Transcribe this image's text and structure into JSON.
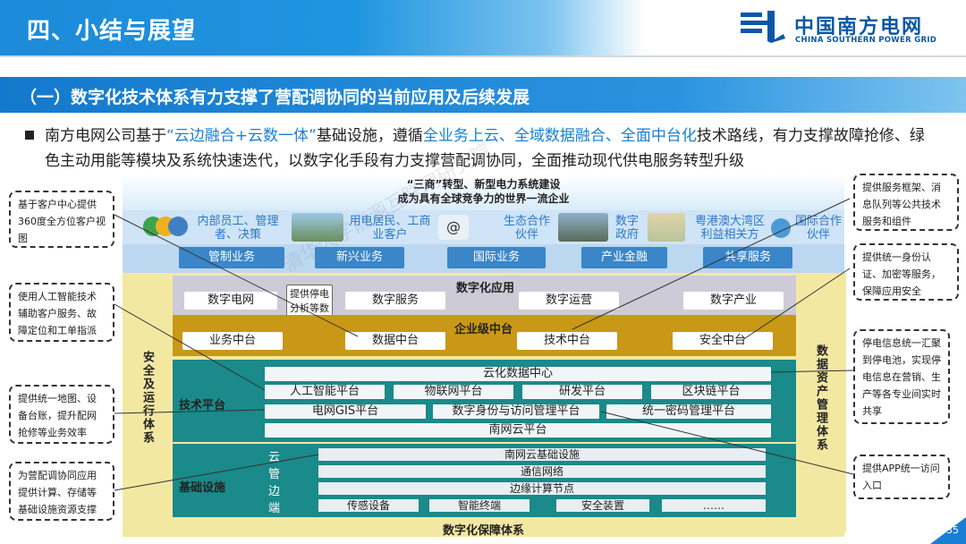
{
  "header": {
    "title": "四、小结与展望",
    "logo_cn": "中国南方电网",
    "logo_en": "CHINA SOUTHERN POWER GRID"
  },
  "section": {
    "title": "（一）数字化技术体系有力支撑了营配调协同的当前应用及后续发展"
  },
  "paragraph": {
    "p1": "南方电网公司基于",
    "h1": "“云边融合+云数一体”",
    "p2": "基础设施，遵循",
    "h2": "全业务上云、全域数据融合、全面中台化",
    "p3": "技术路线，有力支撑故障抢修、绿色主动用能等模块及系统快速迭代，以数字化手段有力支撑营配调协同，全面推动现代供电服务转型升级"
  },
  "diagram": {
    "banner_line1": "“三商”转型、新型电力系统建设",
    "banner_line2": "成为具有全球竞争力的世界一流企业",
    "stakeholders": [
      "内部员工、管理者、决策",
      "用电居民、工商业客户",
      "生态合作伙伴",
      "数字政府",
      "粤港澳大湾区利益相关方",
      "国际合作伙伴"
    ],
    "business": [
      "管制业务",
      "新兴业务",
      "国际业务",
      "产业金融",
      "共享服务"
    ],
    "left_side": "安全及运行体系",
    "right_side": "数据资产管理体系",
    "app_layer": {
      "title": "数字化应用",
      "items": [
        "数字电网",
        "数字服务",
        "数字运营",
        "数字产业"
      ]
    },
    "ent_layer": {
      "title": "企业级中台",
      "items": [
        "业务中台",
        "数据中台",
        "技术中台",
        "安全中台"
      ]
    },
    "tech_layer": {
      "title": "技术平台",
      "top": "云化数据中心",
      "row1": [
        "人工智能平台",
        "物联网平台",
        "研发平台",
        "区块链平台"
      ],
      "row2": [
        "电网GIS平台",
        "数字身份与访问管理平台",
        "统一密码管理平台"
      ],
      "bottom": "南网云平台"
    },
    "base_layer": {
      "title": "基础设施",
      "letters": [
        "云",
        "管",
        "边",
        "端"
      ],
      "rows": [
        "南网云基础设施",
        "通信网络",
        "边缘计算节点"
      ],
      "end_items": [
        "传感设备",
        "智能终端",
        "安全装置",
        "……"
      ]
    },
    "bottom": "数字化保障体系",
    "popup": "提供停电分析等数据服务用"
  },
  "callouts": {
    "l1": "基于客户中心提供360度全方位客户视图",
    "l2": "使用人工智能技术辅助客户服务、故障定位和工单指派",
    "l3": "提供统一地图、设备台账，提升配网抢修等业务效率",
    "l4": "为营配调协同应用提供计算、存储等基础设施资源支撑",
    "r1": "提供服务框架、消息队列等公共技术服务和组件",
    "r2": "提供统一身份认证、加密等服务，保障应用安全",
    "r3": "停电信息统一汇聚到停电池，实现停电信息在营销、生产等各专业间实时共享",
    "r4": "提供APP统一访问入口"
  },
  "page_number": "35",
  "colors": {
    "accent": "#1a7fd4",
    "teal": "#1a8a8a",
    "gold": "#c99816",
    "yellow": "#f3e8a2"
  }
}
